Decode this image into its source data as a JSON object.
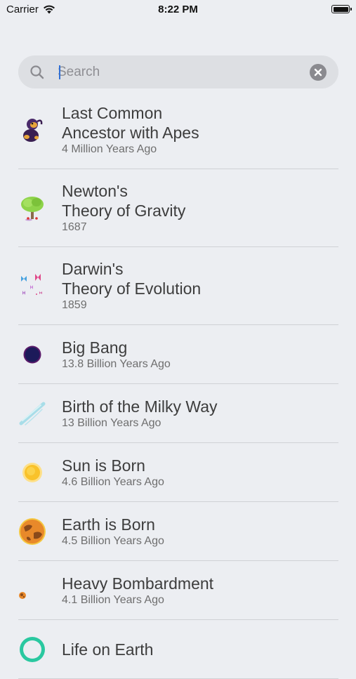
{
  "status_bar": {
    "carrier": "Carrier",
    "time": "8:22 PM",
    "battery_level": 1.0
  },
  "search": {
    "placeholder": "Search",
    "value": "",
    "search_icon": "search-icon",
    "clear_icon": "clear-icon"
  },
  "events": [
    {
      "title_lines": [
        "Last Common",
        "Ancestor with Apes"
      ],
      "subtitle": "4 Million Years Ago",
      "icon": "ape-icon"
    },
    {
      "title_lines": [
        "Newton's",
        "Theory of Gravity"
      ],
      "subtitle": "1687",
      "icon": "apple-tree-icon"
    },
    {
      "title_lines": [
        "Darwin's",
        "Theory of Evolution"
      ],
      "subtitle": "1859",
      "icon": "butterflies-icon"
    },
    {
      "title_lines": [
        "Big Bang"
      ],
      "subtitle": "13.8 Billion Years Ago",
      "icon": "big-bang-icon"
    },
    {
      "title_lines": [
        "Birth of the Milky Way"
      ],
      "subtitle": "13 Billion Years Ago",
      "icon": "milky-way-icon"
    },
    {
      "title_lines": [
        "Sun is Born"
      ],
      "subtitle": "4.6 Billion Years Ago",
      "icon": "sun-icon"
    },
    {
      "title_lines": [
        "Earth is Born"
      ],
      "subtitle": "4.5 Billion Years Ago",
      "icon": "earth-icon"
    },
    {
      "title_lines": [
        "Heavy Bombardment"
      ],
      "subtitle": "4.1 Billion Years Ago",
      "icon": "asteroid-icon"
    },
    {
      "title_lines": [
        "Life on Earth"
      ],
      "subtitle": "",
      "icon": "life-icon"
    }
  ],
  "colors": {
    "background": "#eceef2",
    "search_field": "#dddfe3",
    "caret": "#2f6fd6",
    "title_text": "#3d3d3d",
    "subtitle_text": "#6e6e6e"
  }
}
